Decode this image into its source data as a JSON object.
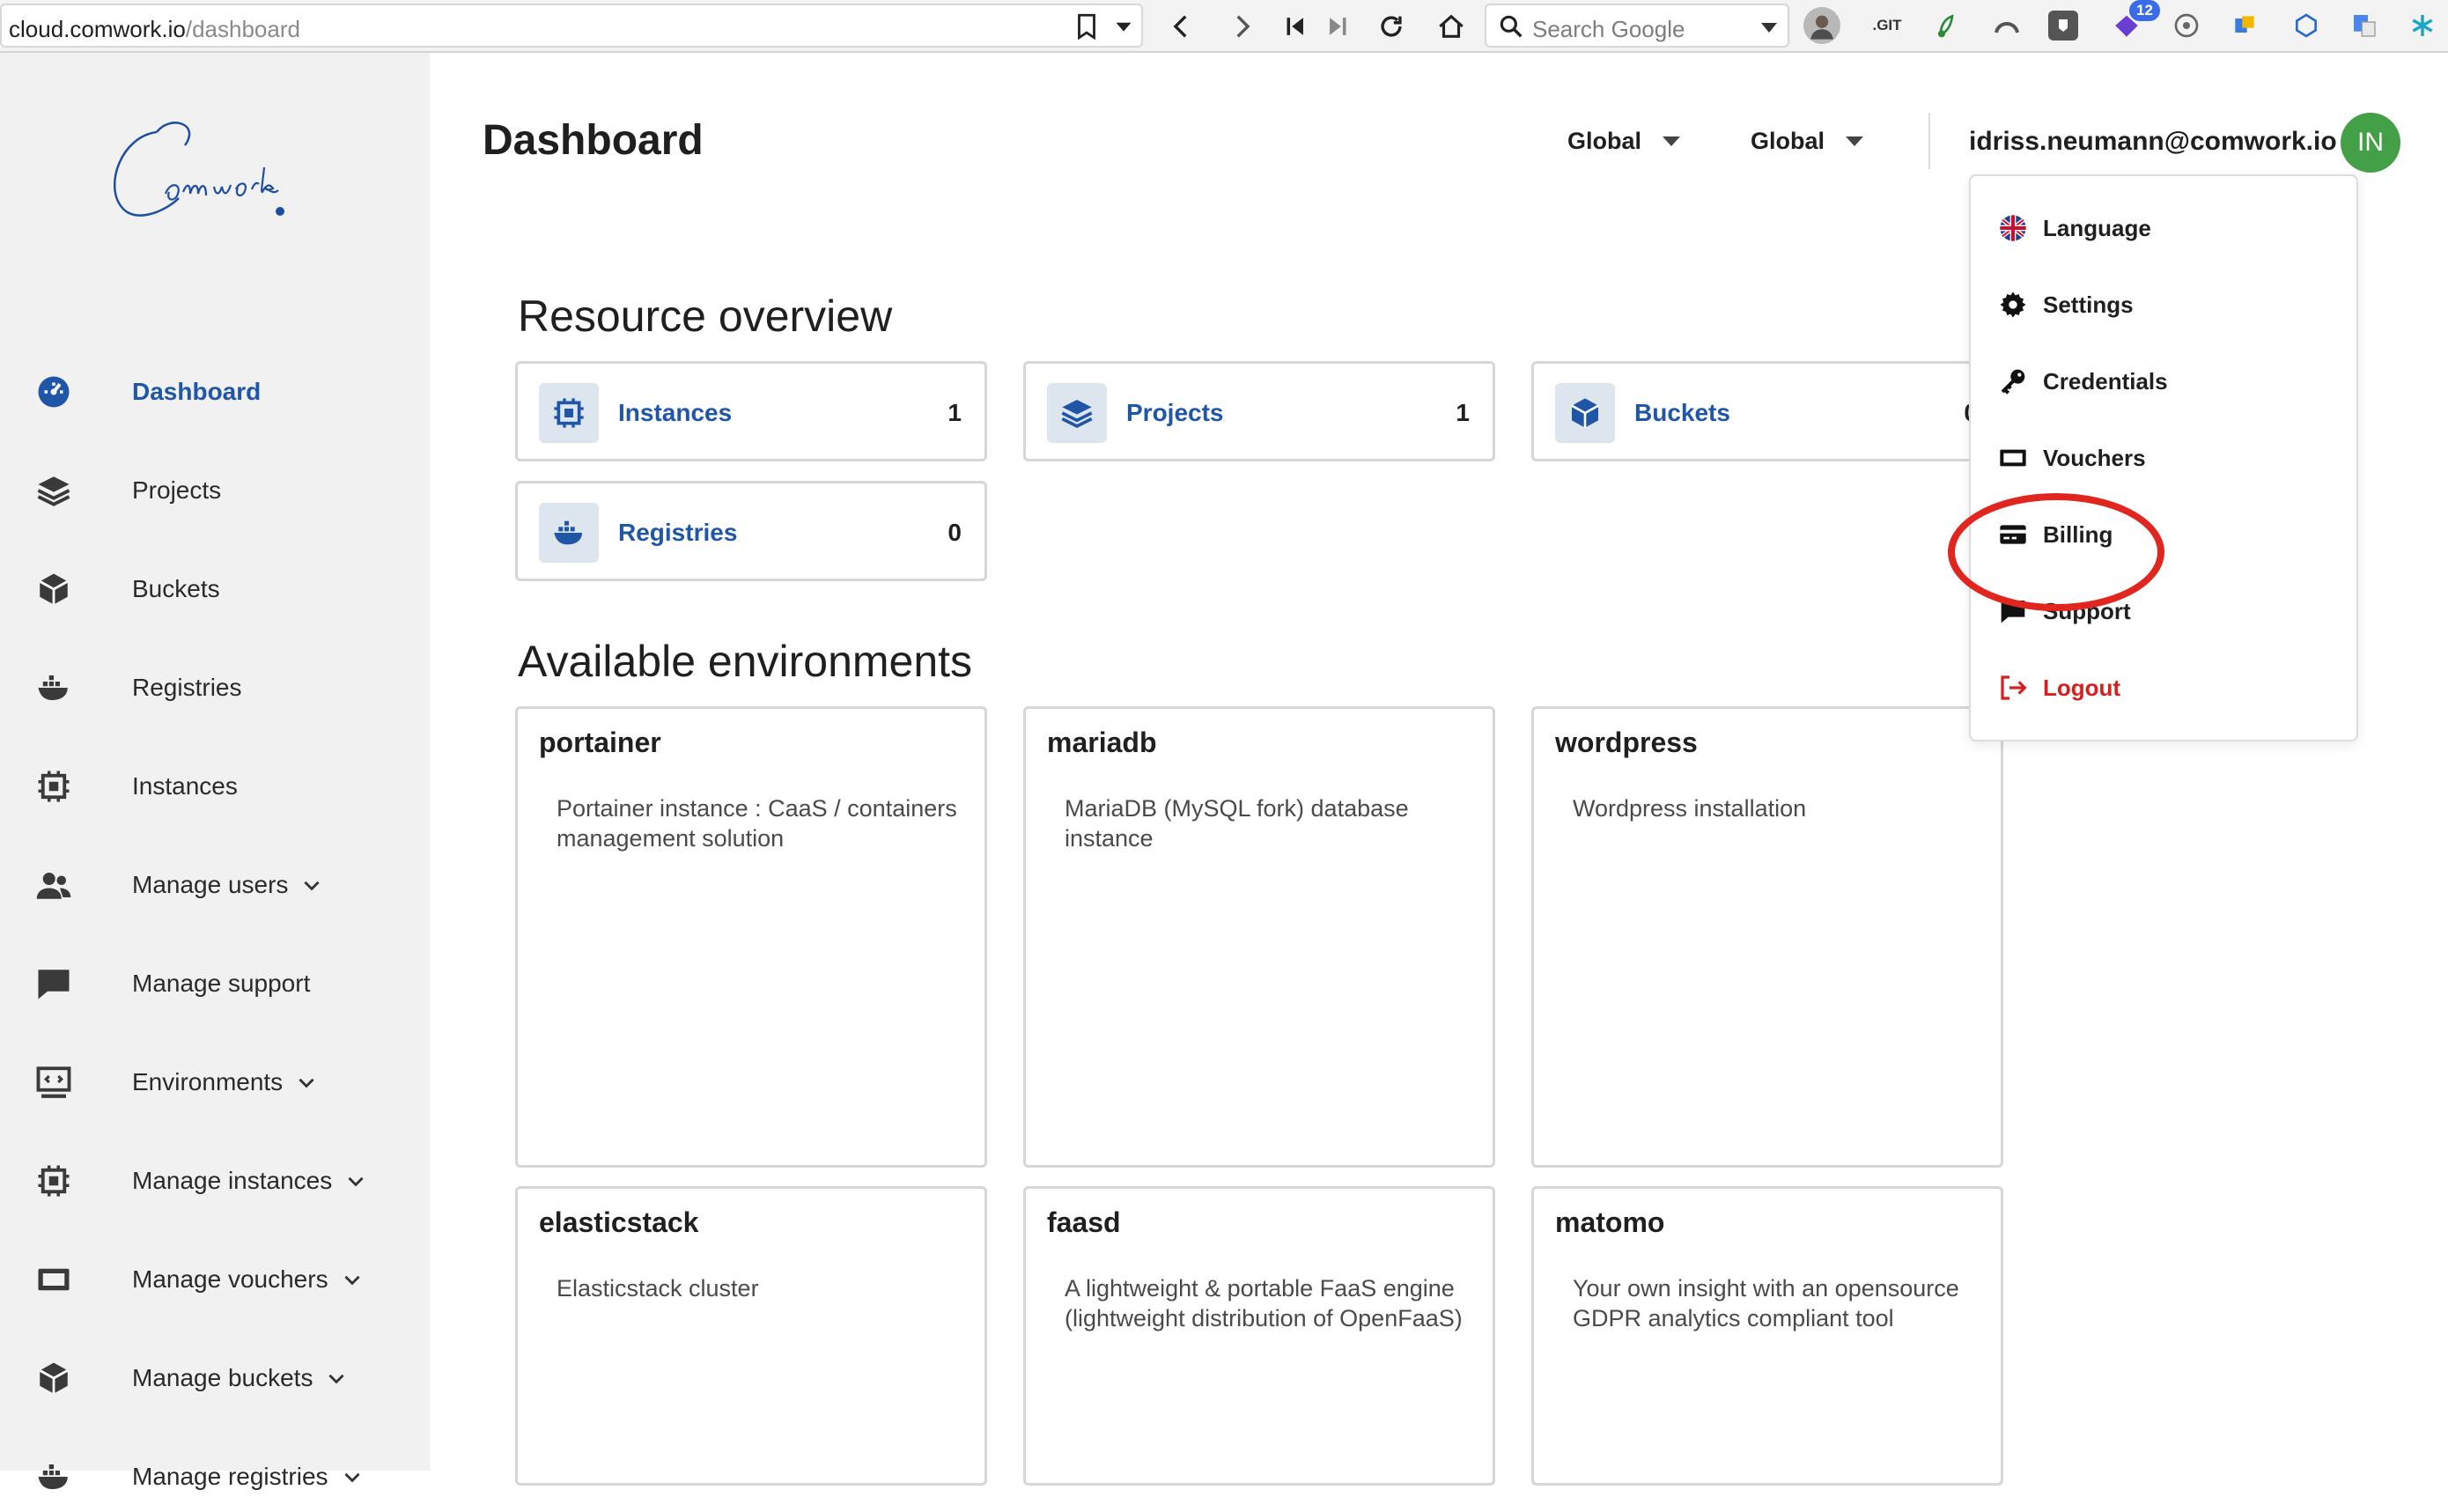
{
  "browser": {
    "url_host": "cloud.comwork.io",
    "url_path": "/dashboard",
    "search_placeholder": "Search Google",
    "extension_badge_count": "12",
    "git_ext_label": ".GIT"
  },
  "sidebar": {
    "logo_text": "Comwork",
    "items": [
      {
        "label": "Dashboard",
        "icon": "dashboard-icon",
        "active": true
      },
      {
        "label": "Projects",
        "icon": "layers-icon"
      },
      {
        "label": "Buckets",
        "icon": "cube-icon"
      },
      {
        "label": "Registries",
        "icon": "docker-icon"
      },
      {
        "label": "Instances",
        "icon": "chip-icon"
      },
      {
        "label": "Manage users",
        "icon": "users-icon",
        "expandable": true
      },
      {
        "label": "Manage support",
        "icon": "chat-icon"
      },
      {
        "label": "Environments",
        "icon": "code-screen-icon",
        "expandable": true
      },
      {
        "label": "Manage instances",
        "icon": "chip-icon",
        "expandable": true
      },
      {
        "label": "Manage vouchers",
        "icon": "ticket-icon",
        "expandable": true
      },
      {
        "label": "Manage buckets",
        "icon": "cube-icon",
        "expandable": true
      },
      {
        "label": "Manage registries",
        "icon": "docker-icon",
        "expandable": true
      }
    ]
  },
  "header": {
    "title": "Dashboard",
    "region_select": "Global",
    "provider_select": "Global",
    "user_email": "idriss.neumann@comwork.io",
    "avatar_initials": "IN"
  },
  "resource_overview": {
    "title": "Resource overview",
    "cards": [
      {
        "label": "Instances",
        "count": "1",
        "icon": "chip-icon"
      },
      {
        "label": "Projects",
        "count": "1",
        "icon": "layers-icon"
      },
      {
        "label": "Buckets",
        "count": "0",
        "icon": "cube-icon"
      },
      {
        "label": "Registries",
        "count": "0",
        "icon": "docker-icon"
      }
    ]
  },
  "environments": {
    "title": "Available environments",
    "cards": [
      {
        "name": "portainer",
        "description": "Portainer instance : CaaS / containers management solution"
      },
      {
        "name": "mariadb",
        "description": "MariaDB (MySQL fork) database instance"
      },
      {
        "name": "wordpress",
        "description": "Wordpress installation"
      },
      {
        "name": "elasticstack",
        "description": "Elasticstack cluster"
      },
      {
        "name": "faasd",
        "description": "A lightweight & portable FaaS engine (lightweight distribution of OpenFaaS)"
      },
      {
        "name": "matomo",
        "description": "Your own insight with an opensource GDPR analytics compliant tool"
      }
    ]
  },
  "user_menu": {
    "items": [
      {
        "label": "Language",
        "icon": "uk-flag-icon"
      },
      {
        "label": "Settings",
        "icon": "gear-icon"
      },
      {
        "label": "Credentials",
        "icon": "key-icon"
      },
      {
        "label": "Vouchers",
        "icon": "ticket-icon"
      },
      {
        "label": "Billing",
        "icon": "credit-card-icon",
        "highlighted": true
      },
      {
        "label": "Support",
        "icon": "chat-icon"
      },
      {
        "label": "Logout",
        "icon": "logout-icon",
        "danger": true
      }
    ]
  },
  "colors": {
    "accent": "#1f56a8",
    "sidebar_bg": "#f1f1f1",
    "avatar": "#43a047",
    "highlight": "#e0261f",
    "danger": "#d62020"
  }
}
